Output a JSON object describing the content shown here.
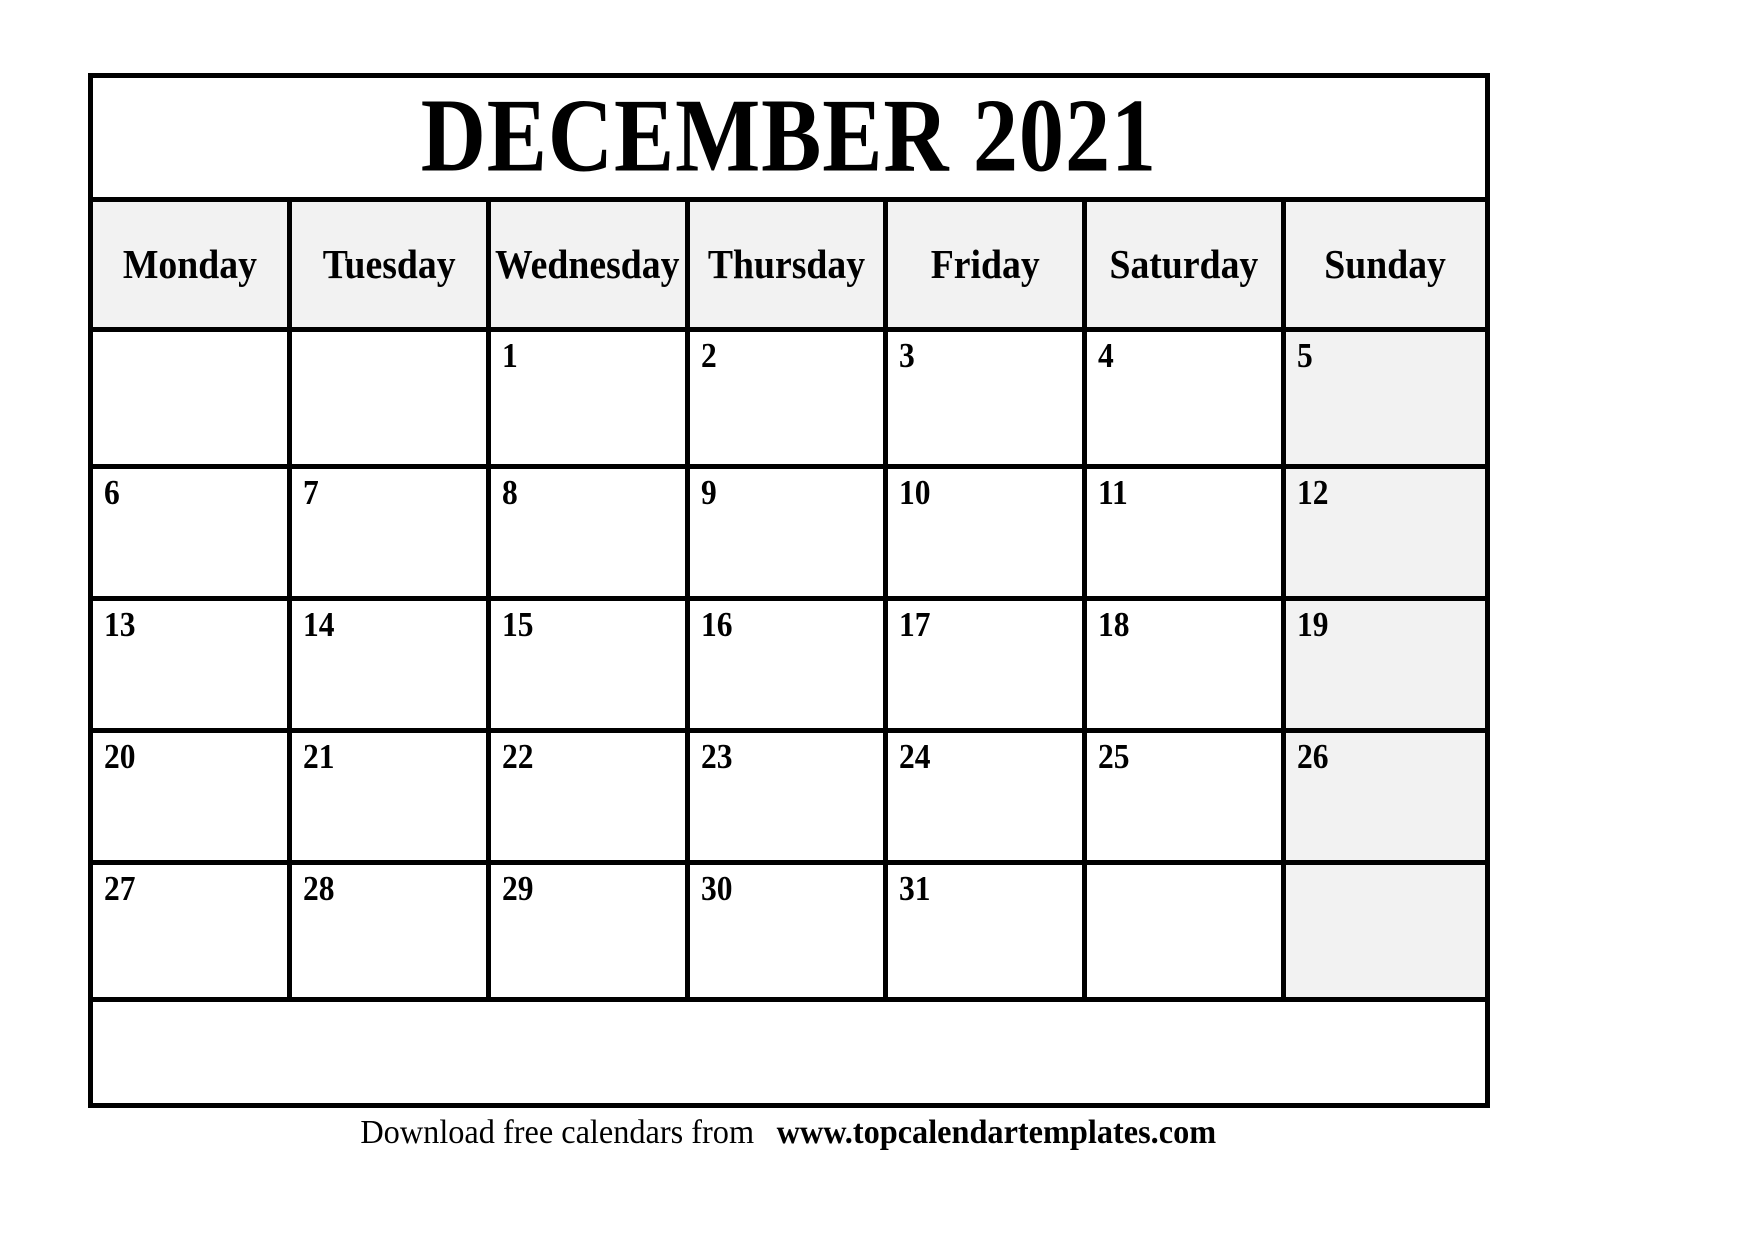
{
  "calendar": {
    "title": "DECEMBER 2021",
    "month": "DECEMBER",
    "year": "2021",
    "weekdays": [
      "Monday",
      "Tuesday",
      "Wednesday",
      "Thursday",
      "Friday",
      "Saturday",
      "Sunday"
    ],
    "weeks": [
      [
        "",
        "",
        "1",
        "2",
        "3",
        "4",
        "5"
      ],
      [
        "6",
        "7",
        "8",
        "9",
        "10",
        "11",
        "12"
      ],
      [
        "13",
        "14",
        "15",
        "16",
        "17",
        "18",
        "19"
      ],
      [
        "20",
        "21",
        "22",
        "23",
        "24",
        "25",
        "26"
      ],
      [
        "27",
        "28",
        "29",
        "30",
        "31",
        "",
        ""
      ]
    ],
    "highlight_column_index": 6,
    "colors": {
      "border": "#000000",
      "header_background": "#f2f2f2",
      "sunday_background": "#f2f2f2",
      "cell_background": "#ffffff",
      "text": "#000000",
      "page_background": "#ffffff"
    }
  },
  "footer": {
    "prefix": "Download free calendars from ",
    "url": "www.topcalendartemplates.com"
  }
}
